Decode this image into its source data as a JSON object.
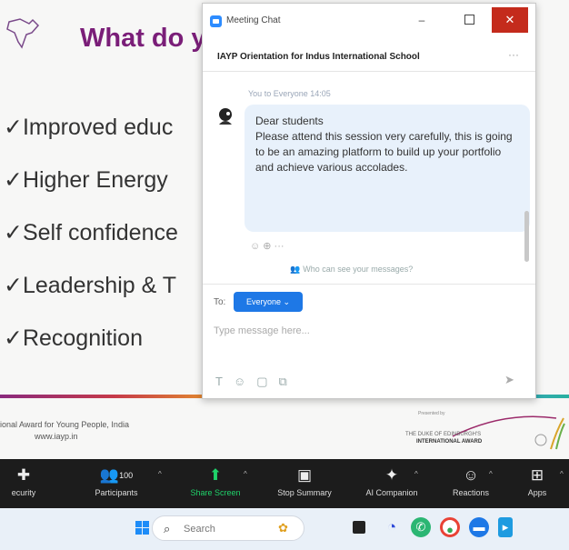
{
  "slide": {
    "title": "What do y",
    "bullets": [
      "✓Improved educ",
      "✓Higher Energy",
      "✓Self confidence",
      "✓Leadership & T",
      "✓Recognition"
    ],
    "footer_left_line1": "ional Award for Young People, India",
    "footer_left_line2": "www.iayp.in",
    "footer_right_top": "Presented by",
    "footer_right_line1": "THE DUKE OF EDINBURGH'S",
    "footer_right_line2": "INTERNATIONAL AWARD"
  },
  "chat": {
    "window_title": "Meeting Chat",
    "minimize_glyph": "–",
    "close_glyph": "✕",
    "header_title": "IAYP Orientation for Indus International School",
    "header_more": "···",
    "message_meta": "You to Everyone 14:05",
    "message_text": "Dear students\nPlease attend this session very carefully, this is going to be an amazing platform to build up your portfolio and achieve various accolades.",
    "message_actions": "☺ ⊕ ···",
    "privacy_note": "Who can see your messages?",
    "to_label": "To:",
    "to_button": "Everyone ⌄",
    "input_placeholder": "Type message here...",
    "send_glyph": "➤"
  },
  "toolbar": {
    "items": [
      {
        "label": "ecurity",
        "icon": "shield-icon",
        "glyph": "✚"
      },
      {
        "label": "Participants",
        "count": "100",
        "icon": "participants-icon",
        "glyph": "👥"
      },
      {
        "label": "Share Screen",
        "icon": "share-screen-icon",
        "glyph": "⬆"
      },
      {
        "label": "Stop Summary",
        "icon": "summary-icon",
        "glyph": "▣"
      },
      {
        "label": "AI Companion",
        "icon": "sparkle-icon",
        "glyph": "✦"
      },
      {
        "label": "Reactions",
        "icon": "reaction-icon",
        "glyph": "☺"
      },
      {
        "label": "Apps",
        "icon": "apps-icon",
        "glyph": "⊞"
      }
    ],
    "caret": "^"
  },
  "taskbar": {
    "search_placeholder": "Search"
  }
}
